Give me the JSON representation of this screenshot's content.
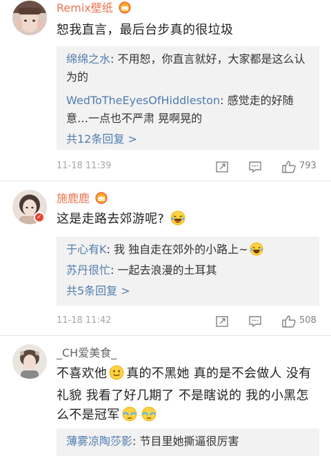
{
  "comments": [
    {
      "username": "Remix壁纸",
      "text": "恕我直言，最后台步真的很垃圾",
      "replies": [
        {
          "user": "绵绵之水",
          "text": ": 不用恕，你直言就好，大家都是这么认为的"
        },
        {
          "user": "WedToTheEyesOfHiddleston",
          "text": ": 感觉走的好随意…一点也不严肃 晃啊晃的"
        }
      ],
      "more": "共12条回复 >",
      "time": "11-18 11:39",
      "likes": "793"
    },
    {
      "username": "施鹿鹿",
      "text": "这是走路去郊游呢?",
      "replies": [
        {
          "user": "于心有K",
          "text": ": 我 独自走在郊外的小路上~"
        },
        {
          "user": "苏丹很忙",
          "text": ": 一起去浪漫的土耳其"
        }
      ],
      "more": "共5条回复 >",
      "time": "11-18 11:42",
      "likes": "508"
    },
    {
      "username": "_CH爱美食_",
      "text_part1": "不喜欢他",
      "text_part2": "真的不黑她 真的是不会做人 没有礼貌 我看了好几期了 不是瞎说的 我的小黑怎么不是冠军",
      "replies": [
        {
          "user": "薄雾凉陶莎影",
          "text": ": 节目里她撕逼很厉害"
        }
      ]
    }
  ],
  "icons": [
    "forward-icon",
    "comment-icon",
    "like-icon",
    "crown-icon",
    "emoji-icon"
  ],
  "colors": {
    "username": "#eb7350",
    "reply_user": "#507daf",
    "reply_bg": "#f2f2f2",
    "time": "#a6a6a6"
  }
}
